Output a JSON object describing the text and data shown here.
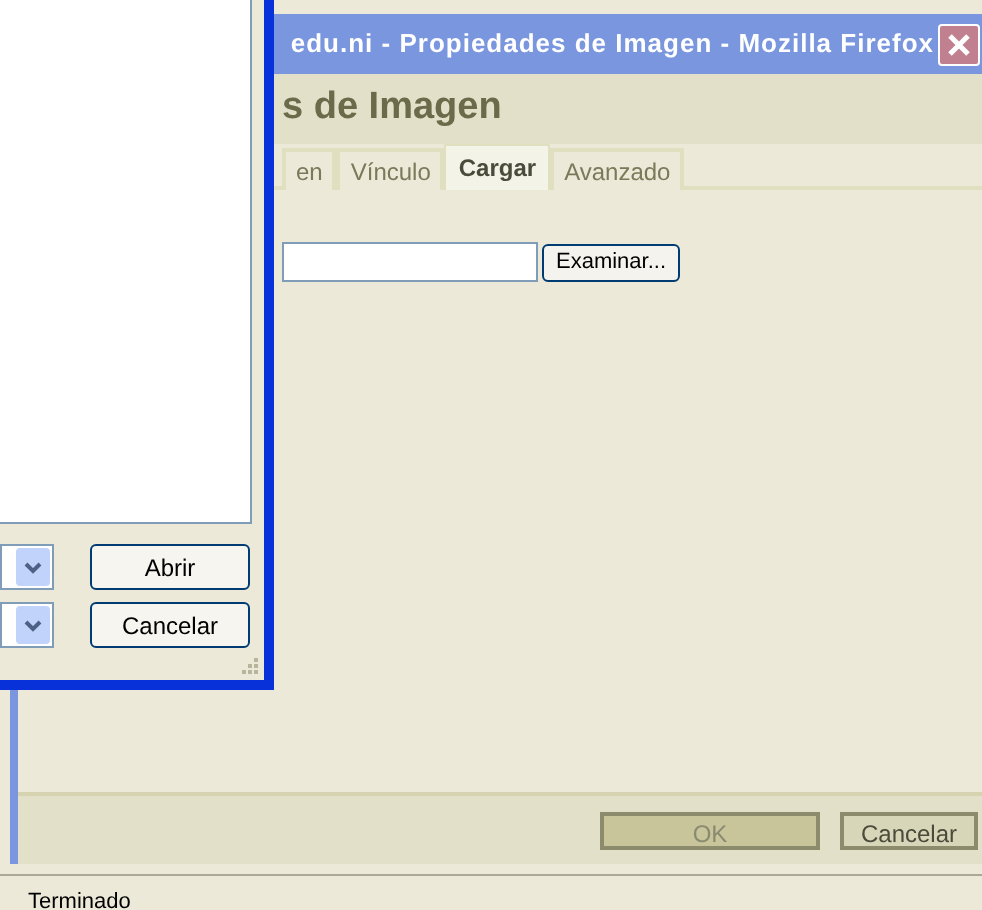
{
  "browser_dialog": {
    "title": "edu.ni - Propiedades de Imagen - Mozilla Firefox",
    "heading": "s de Imagen",
    "tabs": [
      {
        "label": "en",
        "selected": false
      },
      {
        "label": "Vínculo",
        "selected": false
      },
      {
        "label": "Cargar",
        "selected": true
      },
      {
        "label": "Avanzado",
        "selected": false
      }
    ],
    "browse_button": "Examinar...",
    "buttons": [
      {
        "label": "OK",
        "disabled": true
      },
      {
        "label": "Cancelar",
        "disabled": false
      }
    ]
  },
  "file_dialog": {
    "buttons": [
      "Abrir",
      "Cancelar"
    ]
  },
  "status_bar": "Terminado"
}
